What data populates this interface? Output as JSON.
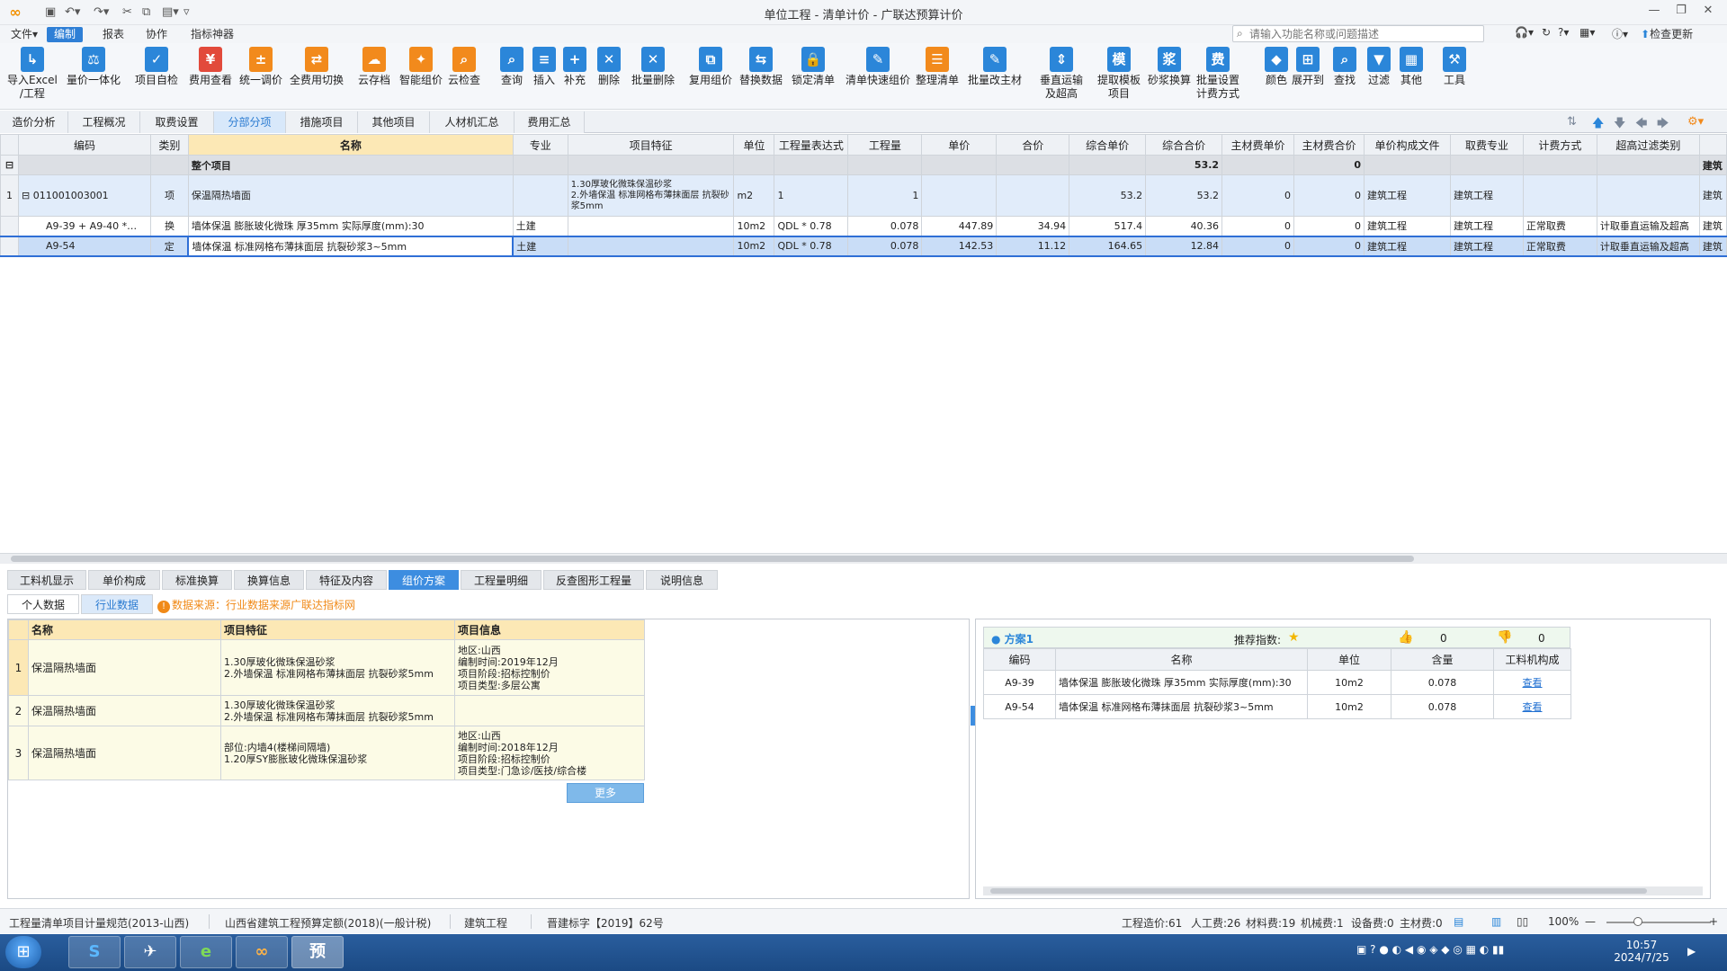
{
  "app": {
    "title": "单位工程 - 清单计价 - 广联达预算计价",
    "window_controls": [
      "—",
      "❐",
      "✕"
    ]
  },
  "menubar": {
    "items": [
      "文件▾",
      "编制",
      "报表",
      "协作",
      "指标神器"
    ],
    "search_placeholder": "请输入功能名称或问题描述",
    "check_update": "检查更新"
  },
  "ribbon": {
    "buttons": [
      {
        "label": "导入Excel\n/工程",
        "icon": "import-icon",
        "glyph": "↳",
        "color": "#2b86d9"
      },
      {
        "label": "量价一体化",
        "icon": "integration-icon",
        "glyph": "⚖",
        "color": "#2b86d9"
      },
      {
        "label": "项目自检",
        "icon": "check-icon",
        "glyph": "✓",
        "color": "#2b86d9"
      },
      {
        "label": "费用查看",
        "icon": "fee-view-icon",
        "glyph": "¥",
        "color": "#e24a3b"
      },
      {
        "label": "统一调价",
        "icon": "price-adjust-icon",
        "glyph": "±",
        "color": "#f28a1c"
      },
      {
        "label": "全费用切换",
        "icon": "fee-switch-icon",
        "glyph": "⇄",
        "color": "#f28a1c"
      },
      {
        "label": "云存档",
        "icon": "cloud-save-icon",
        "glyph": "☁",
        "color": "#f28a1c"
      },
      {
        "label": "智能组价",
        "icon": "smart-price-icon",
        "glyph": "✦",
        "color": "#f28a1c"
      },
      {
        "label": "云检查",
        "icon": "cloud-check-icon",
        "glyph": "⌕",
        "color": "#f28a1c"
      },
      {
        "label": "查询",
        "icon": "query-icon",
        "glyph": "⌕",
        "color": "#2b86d9"
      },
      {
        "label": "插入",
        "icon": "insert-icon",
        "glyph": "≡",
        "color": "#2b86d9"
      },
      {
        "label": "补充",
        "icon": "supplement-icon",
        "glyph": "+",
        "color": "#2b86d9"
      },
      {
        "label": "删除",
        "icon": "delete-icon",
        "glyph": "✕",
        "color": "#2b86d9"
      },
      {
        "label": "批量删除",
        "icon": "batch-delete-icon",
        "glyph": "✕",
        "color": "#2b86d9"
      },
      {
        "label": "复用组价",
        "icon": "reuse-icon",
        "glyph": "⧉",
        "color": "#2b86d9"
      },
      {
        "label": "替换数据",
        "icon": "replace-icon",
        "glyph": "⇆",
        "color": "#2b86d9"
      },
      {
        "label": "锁定清单",
        "icon": "lock-icon",
        "glyph": "🔒",
        "color": "#2b86d9"
      },
      {
        "label": "清单快速组价",
        "icon": "quick-price-icon",
        "glyph": "✎",
        "color": "#2b86d9"
      },
      {
        "label": "整理清单",
        "icon": "sort-list-icon",
        "glyph": "☰",
        "color": "#f28a1c"
      },
      {
        "label": "批量改主材",
        "icon": "batch-material-icon",
        "glyph": "✎",
        "color": "#2b86d9"
      },
      {
        "label": "垂直运输\n及超高",
        "icon": "vertical-transport-icon",
        "glyph": "⇕",
        "color": "#2b86d9"
      },
      {
        "label": "提取模板\n项目",
        "icon": "template-icon",
        "glyph": "模",
        "color": "#2b86d9"
      },
      {
        "label": "砂浆换算",
        "icon": "mortar-icon",
        "glyph": "浆",
        "color": "#2b86d9"
      },
      {
        "label": "批量设置\n计费方式",
        "icon": "batch-fee-icon",
        "glyph": "费",
        "color": "#2b86d9"
      },
      {
        "label": "颜色",
        "icon": "color-icon",
        "glyph": "◆",
        "color": "#2b86d9"
      },
      {
        "label": "展开到",
        "icon": "expand-icon",
        "glyph": "⊞",
        "color": "#2b86d9"
      },
      {
        "label": "查找",
        "icon": "find-icon",
        "glyph": "⌕",
        "color": "#2b86d9"
      },
      {
        "label": "过滤",
        "icon": "filter-icon",
        "glyph": "▼",
        "color": "#2b86d9"
      },
      {
        "label": "其他",
        "icon": "other-icon",
        "glyph": "▦",
        "color": "#2b86d9"
      },
      {
        "label": "工具",
        "icon": "tool-icon",
        "glyph": "⚒",
        "color": "#2b86d9"
      }
    ]
  },
  "tabs": [
    "造价分析",
    "工程概况",
    "取费设置",
    "分部分项",
    "措施项目",
    "其他项目",
    "人材机汇总",
    "费用汇总"
  ],
  "grid": {
    "headers": [
      "编码",
      "类别",
      "名称",
      "专业",
      "项目特征",
      "单位",
      "工程量表达式",
      "工程量",
      "单价",
      "合价",
      "综合单价",
      "综合合价",
      "主材费单价",
      "主材费合价",
      "单价构成文件",
      "取费专业",
      "计费方式",
      "超高过滤类别",
      ""
    ],
    "total_row": {
      "label": "整个项目",
      "total": "53.2",
      "zero": "0",
      "last": "建筑"
    },
    "rows": [
      {
        "num": "1",
        "code": "011001003001",
        "type": "项",
        "name": "保温隔热墙面",
        "spec": "",
        "feature": "1.30厚玻化微珠保温砂浆\n2.外墙保温 标准网格布薄抹面层 抗裂砂浆5mm",
        "unit": "m2",
        "expr": "1",
        "qty": "1",
        "price": "",
        "sum": "",
        "uprice": "53.2",
        "usum": "53.2",
        "mprice": "0",
        "msum": "0",
        "file": "建筑工程",
        "feespec": "建筑工程",
        "mode": "",
        "filter": "",
        "extra": "建筑"
      },
      {
        "num": "",
        "code": "A9-39 + A9-40 *…",
        "type": "换",
        "name": "墙体保温 膨胀玻化微珠 厚35mm  实际厚度(mm):30",
        "spec": "土建",
        "feature": "",
        "unit": "10m2",
        "expr": "QDL * 0.78",
        "qty": "0.078",
        "price": "447.89",
        "sum": "34.94",
        "uprice": "517.4",
        "usum": "40.36",
        "mprice": "0",
        "msum": "0",
        "file": "建筑工程",
        "feespec": "建筑工程",
        "mode": "正常取费",
        "filter": "计取垂直运输及超高",
        "extra": "建筑"
      },
      {
        "num": "",
        "code": "A9-54",
        "type": "定",
        "name": "墙体保温 标准网格布薄抹面层 抗裂砂浆3~5mm",
        "spec": "土建",
        "feature": "",
        "unit": "10m2",
        "expr": "QDL * 0.78",
        "qty": "0.078",
        "price": "142.53",
        "sum": "11.12",
        "uprice": "164.65",
        "usum": "12.84",
        "mprice": "0",
        "msum": "0",
        "file": "建筑工程",
        "feespec": "建筑工程",
        "mode": "正常取费",
        "filter": "计取垂直运输及超高",
        "extra": "建筑"
      }
    ]
  },
  "lower_tabs": [
    "工料机显示",
    "单价构成",
    "标准换算",
    "换算信息",
    "特征及内容",
    "组价方案",
    "工程量明细",
    "反查图形工程量",
    "说明信息"
  ],
  "sub_tabs": [
    "个人数据",
    "行业数据"
  ],
  "notice": "数据来源：行业数据来源广联达指标网",
  "left_table": {
    "headers": [
      "名称",
      "项目特征",
      "项目信息"
    ],
    "rows": [
      {
        "num": "1",
        "name": "保温隔热墙面",
        "feature": "1.30厚玻化微珠保温砂浆\n2.外墙保温 标准网格布薄抹面层 抗裂砂浆5mm",
        "info": "地区:山西\n编制时间:2019年12月\n项目阶段:招标控制价\n项目类型:多层公寓"
      },
      {
        "num": "2",
        "name": "保温隔热墙面",
        "feature": "1.30厚玻化微珠保温砂浆\n2.外墙保温 标准网格布薄抹面层 抗裂砂浆5mm",
        "info": ""
      },
      {
        "num": "3",
        "name": "保温隔热墙面",
        "feature": "部位:内墙4(楼梯间隔墙)\n1.20厚SY膨胀玻化微珠保温砂浆",
        "info": "地区:山西\n编制时间:2018年12月\n项目阶段:招标控制价\n项目类型:门急诊/医技/综合楼"
      }
    ],
    "more_button": "更多"
  },
  "plan": {
    "title": "方案1",
    "recommend_label": "推荐指数:",
    "likes": "0",
    "dislikes": "0",
    "headers": [
      "编码",
      "名称",
      "单位",
      "含量",
      "工料机构成"
    ],
    "rows": [
      {
        "code": "A9-39",
        "name": "墙体保温 膨胀玻化微珠 厚35mm  实际厚度(mm):30",
        "unit": "10m2",
        "amount": "0.078",
        "action": "查看"
      },
      {
        "code": "A9-54",
        "name": "墙体保温 标准网格布薄抹面层 抗裂砂浆3~5mm",
        "unit": "10m2",
        "amount": "0.078",
        "action": "查看"
      }
    ]
  },
  "status": {
    "left": [
      "工程量清单项目计量规范(2013-山西)",
      "山西省建筑工程预算定额(2018)(一般计税)",
      "建筑工程",
      "晋建标字【2019】62号"
    ],
    "right": [
      "工程造价:61",
      "人工费:26",
      "材料费:19",
      "机械费:1",
      "设备费:0",
      "主材费:0"
    ],
    "zoom": "100%"
  },
  "taskbar": {
    "apps": [
      "S",
      "✈",
      "e",
      "∞",
      "预"
    ],
    "time": "10:57",
    "date": "2024/7/25"
  }
}
